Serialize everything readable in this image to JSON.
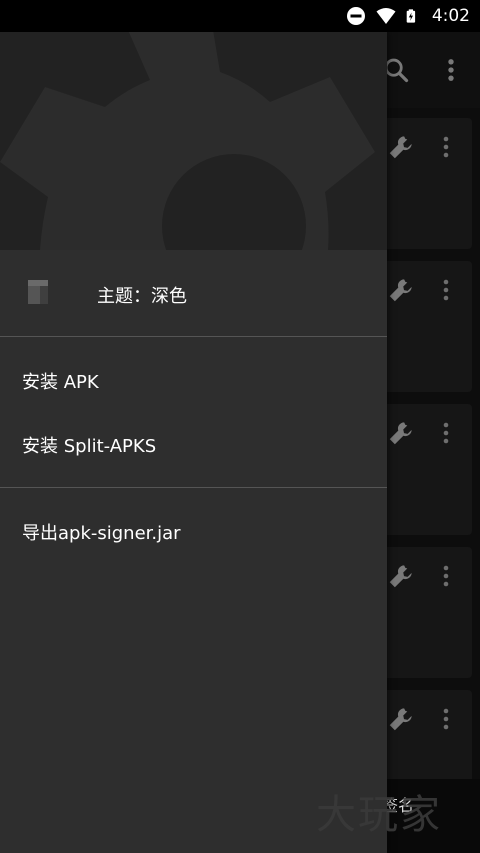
{
  "status_bar": {
    "time": "4:02",
    "icons": [
      "do-not-disturb-icon",
      "wifi-icon",
      "battery-charging-icon"
    ]
  },
  "drawer": {
    "theme_label": "主题：深色",
    "sections": [
      {
        "items": [
          "安装 APK",
          "安装 Split-APKS"
        ]
      },
      {
        "items": [
          "导出apk-signer.jar"
        ]
      }
    ]
  },
  "background_app": {
    "toolbar_icons": [
      "search-icon",
      "more-vert-icon"
    ],
    "card_icons": [
      "wrench-icon",
      "more-vert-icon"
    ],
    "bottom_label": "签名"
  },
  "watermark": "大玩家",
  "colors": {
    "drawer_bg": "#2e2e2e",
    "header_bg": "#222222",
    "divider": "#555555",
    "text": "#ffffff"
  }
}
